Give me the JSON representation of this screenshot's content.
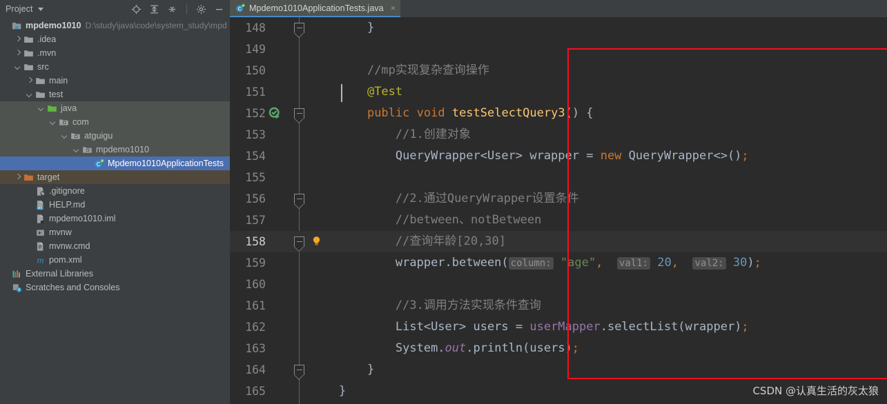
{
  "sidebar": {
    "tool_window_title": "Project",
    "toolbar_icons": [
      {
        "name": "locate-icon",
        "label": "Select Opened File"
      },
      {
        "name": "expand-all-icon",
        "label": "Expand All"
      },
      {
        "name": "collapse-all-icon",
        "label": "Collapse All"
      },
      {
        "name": "gear-icon",
        "label": "Settings"
      },
      {
        "name": "minimize-icon",
        "label": "Hide"
      }
    ],
    "tree": [
      {
        "label": "mpdemo1010",
        "path": "D:\\study\\java\\code\\system_study\\mpd",
        "icon": "project-module-icon",
        "indent": 0,
        "arrow": "none",
        "style": "root"
      },
      {
        "label": ".idea",
        "icon": "folder-icon",
        "indent": 1,
        "arrow": "right",
        "style": "normal"
      },
      {
        "label": ".mvn",
        "icon": "folder-icon",
        "indent": 1,
        "arrow": "right",
        "style": "normal"
      },
      {
        "label": "src",
        "icon": "folder-icon",
        "indent": 1,
        "arrow": "down",
        "style": "normal"
      },
      {
        "label": "main",
        "icon": "folder-icon",
        "indent": 2,
        "arrow": "right",
        "style": "normal"
      },
      {
        "label": "test",
        "icon": "folder-icon",
        "indent": 2,
        "arrow": "down",
        "style": "normal"
      },
      {
        "label": "java",
        "icon": "test-source-root-icon",
        "indent": 3,
        "arrow": "down",
        "style": "sel-green"
      },
      {
        "label": "com",
        "icon": "package-icon",
        "indent": 4,
        "arrow": "down",
        "style": "sel-green"
      },
      {
        "label": "atguigu",
        "icon": "package-icon",
        "indent": 5,
        "arrow": "down",
        "style": "sel-green"
      },
      {
        "label": "mpdemo1010",
        "icon": "package-icon",
        "indent": 6,
        "arrow": "down",
        "style": "sel-green"
      },
      {
        "label": "Mpdemo1010ApplicationTests",
        "icon": "java-test-class-icon",
        "indent": 7,
        "arrow": "none",
        "style": "sel-blue"
      },
      {
        "label": "target",
        "icon": "excluded-folder-icon",
        "indent": 1,
        "arrow": "right",
        "style": "sel-brown"
      },
      {
        "label": ".gitignore",
        "icon": "gitignore-file-icon",
        "indent": 2,
        "arrow": "none",
        "style": "normal"
      },
      {
        "label": "HELP.md",
        "icon": "markdown-file-icon",
        "indent": 2,
        "arrow": "none",
        "style": "normal"
      },
      {
        "label": "mpdemo1010.iml",
        "icon": "iml-file-icon",
        "indent": 2,
        "arrow": "none",
        "style": "normal"
      },
      {
        "label": "mvnw",
        "icon": "shell-script-icon",
        "indent": 2,
        "arrow": "none",
        "style": "normal"
      },
      {
        "label": "mvnw.cmd",
        "icon": "cmd-file-icon",
        "indent": 2,
        "arrow": "none",
        "style": "normal"
      },
      {
        "label": "pom.xml",
        "icon": "maven-pom-icon",
        "indent": 2,
        "arrow": "none",
        "style": "normal"
      },
      {
        "label": "External Libraries",
        "icon": "libraries-icon",
        "indent": 0,
        "arrow": "none",
        "style": "normal"
      },
      {
        "label": "Scratches and Consoles",
        "icon": "scratches-icon",
        "indent": 0,
        "arrow": "none",
        "style": "normal"
      }
    ]
  },
  "editor": {
    "tab": {
      "label": "Mpdemo1010ApplicationTests.java",
      "icon": "java-test-class-icon",
      "close_label": "×"
    },
    "gutter": {
      "run_icon_line": 152,
      "bulb_icon_line": 158,
      "highlighted_line": 158
    },
    "lines": [
      {
        "num": "148",
        "tokens": [
          {
            "t": "}",
            "c": "punc",
            "indent": 1
          }
        ]
      },
      {
        "num": "149",
        "tokens": []
      },
      {
        "num": "150",
        "tokens": [
          {
            "t": "//mp实现复杂查询操作",
            "c": "cmt",
            "indent": 1
          }
        ]
      },
      {
        "num": "151",
        "tokens": [
          {
            "t": "@Test",
            "c": "anno",
            "indent": 1
          }
        ]
      },
      {
        "num": "152",
        "tokens": [
          {
            "t": "public",
            "c": "kw",
            "indent": 1
          },
          {
            "t": " ",
            "c": "id"
          },
          {
            "t": "void",
            "c": "kw"
          },
          {
            "t": " ",
            "c": "id"
          },
          {
            "t": "testSelectQuery3",
            "c": "mth"
          },
          {
            "t": "() {",
            "c": "punc"
          }
        ]
      },
      {
        "num": "153",
        "tokens": [
          {
            "t": "//1.创建对象",
            "c": "cmt",
            "indent": 2
          }
        ]
      },
      {
        "num": "154",
        "tokens": [
          {
            "t": "QueryWrapper<User> wrapper = ",
            "c": "id",
            "indent": 2
          },
          {
            "t": "new",
            "c": "kw"
          },
          {
            "t": " QueryWrapper<>()",
            "c": "id"
          },
          {
            "t": ";",
            "c": "semi"
          }
        ]
      },
      {
        "num": "155",
        "tokens": []
      },
      {
        "num": "156",
        "tokens": [
          {
            "t": "//2.通过QueryWrapper设置条件",
            "c": "cmt",
            "indent": 2
          }
        ]
      },
      {
        "num": "157",
        "tokens": [
          {
            "t": "//between、notBetween",
            "c": "cmt",
            "indent": 2
          }
        ]
      },
      {
        "num": "158",
        "tokens": [
          {
            "t": "//查询年龄[20,30]",
            "c": "cmt",
            "indent": 2
          }
        ]
      },
      {
        "num": "159",
        "tokens": [
          {
            "t": "wrapper.between(",
            "c": "id",
            "indent": 2
          },
          {
            "t": "column:",
            "c": "hint"
          },
          {
            "t": " ",
            "c": "id"
          },
          {
            "t": "\"age\"",
            "c": "str"
          },
          {
            "t": ",",
            "c": "semi"
          },
          {
            "t": "  ",
            "c": "id"
          },
          {
            "t": "val1:",
            "c": "hint"
          },
          {
            "t": " ",
            "c": "id"
          },
          {
            "t": "20",
            "c": "num"
          },
          {
            "t": ",",
            "c": "semi"
          },
          {
            "t": "  ",
            "c": "id"
          },
          {
            "t": "val2:",
            "c": "hint"
          },
          {
            "t": " ",
            "c": "id"
          },
          {
            "t": "30",
            "c": "num"
          },
          {
            "t": ")",
            "c": "punc"
          },
          {
            "t": ";",
            "c": "semi"
          }
        ]
      },
      {
        "num": "160",
        "tokens": []
      },
      {
        "num": "161",
        "tokens": [
          {
            "t": "//3.调用方法实现条件查询",
            "c": "cmt",
            "indent": 2
          }
        ]
      },
      {
        "num": "162",
        "tokens": [
          {
            "t": "List<User> users = ",
            "c": "id",
            "indent": 2
          },
          {
            "t": "userMapper",
            "c": "fld"
          },
          {
            "t": ".selectList(wrapper)",
            "c": "id"
          },
          {
            "t": ";",
            "c": "semi"
          }
        ]
      },
      {
        "num": "163",
        "tokens": [
          {
            "t": "System.",
            "c": "id",
            "indent": 2
          },
          {
            "t": "out",
            "c": "stat"
          },
          {
            "t": ".println(users)",
            "c": "id"
          },
          {
            "t": ";",
            "c": "semi"
          }
        ]
      },
      {
        "num": "164",
        "tokens": [
          {
            "t": "}",
            "c": "punc",
            "indent": 1
          }
        ]
      },
      {
        "num": "165",
        "tokens": [
          {
            "t": "}",
            "c": "punc",
            "indent": 0
          }
        ]
      }
    ]
  },
  "annotation": {
    "red_box_color": "#fc0d1c",
    "watermark": "CSDN @认真生活的灰太狼"
  },
  "colors": {
    "sidebar_bg": "#3c3f41",
    "editor_bg": "#2b2b2b",
    "selection_blue": "#4b6eaf",
    "tab_underline": "#4a88c7",
    "comment": "#808080",
    "keyword": "#cc7832",
    "string": "#6a8759",
    "number": "#6897bb",
    "annotation": "#bbb529",
    "method": "#ffc66d",
    "field": "#9876aa"
  }
}
